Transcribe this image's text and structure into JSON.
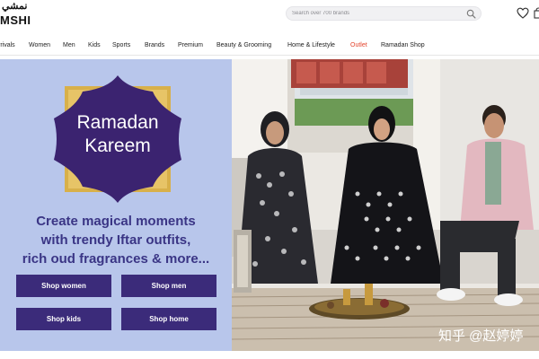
{
  "header": {
    "logo_arabic": "نمشي",
    "logo_text": "MSHI",
    "search_placeholder": "Search over 700 brands"
  },
  "nav": {
    "items": [
      "rrivals",
      "Women",
      "Men",
      "Kids",
      "Sports",
      "Brands",
      "Premium",
      "Beauty & Grooming",
      "Home & Lifestyle",
      "Outlet",
      "Ramadan Shop"
    ]
  },
  "hero": {
    "badge_line1": "Ramadan",
    "badge_line2": "Kareem",
    "copy_line1": "Create magical moments",
    "copy_line2": "with trendy Iftar outfits,",
    "copy_line3": "rich oud fragrances & more...",
    "buttons": {
      "shop_women": "Shop women",
      "shop_men": "Shop men",
      "shop_kids": "Shop kids",
      "shop_home": "Shop home"
    },
    "colors": {
      "panel": "#b8c6eb",
      "badge": "#3b2370",
      "gold": "#d8b04a",
      "button": "#3b2b7a",
      "copy": "#3a3585",
      "outlet": "#e3432b"
    }
  },
  "watermark": "知乎 @赵婷婷"
}
